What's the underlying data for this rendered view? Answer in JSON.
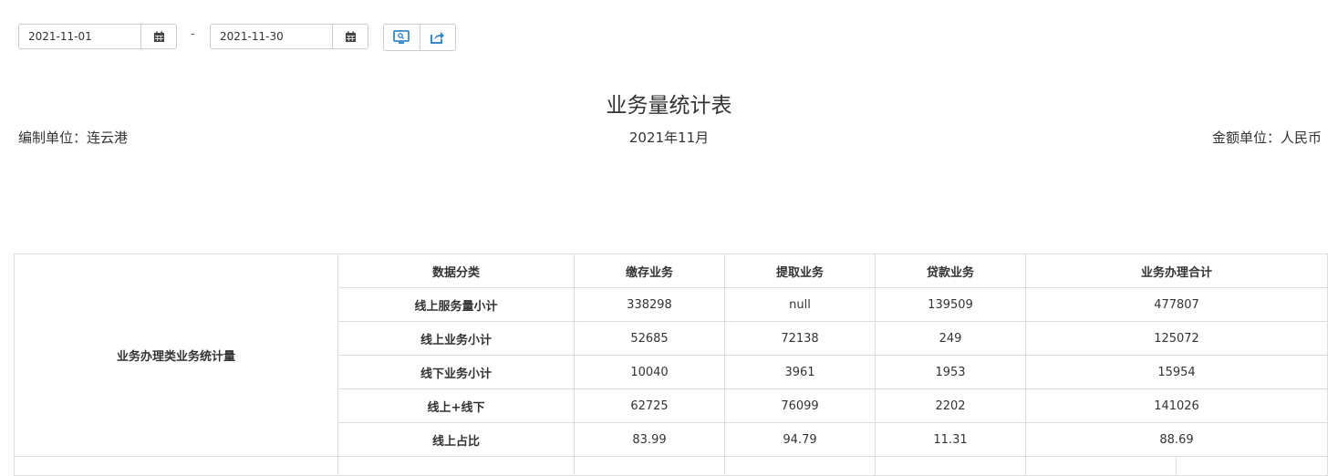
{
  "filters": {
    "start_date": "2021-11-01",
    "end_date": "2021-11-30",
    "separator": "-",
    "calendar_icon": "calendar-icon",
    "buttons": [
      "monitor-icon",
      "share-icon"
    ]
  },
  "report": {
    "title": "业务量统计表",
    "compiler": "编制单位：连云港",
    "period": "2021年11月",
    "currency_unit": "金额单位：人民币"
  },
  "table": {
    "group_label": "业务办理类业务统计量",
    "headers": [
      "数据分类",
      "缴存业务",
      "提取业务",
      "贷款业务",
      "业务办理合计"
    ],
    "rows": [
      {
        "label": "线上服务量小计",
        "values": [
          "338298",
          "null",
          "139509",
          "477807"
        ]
      },
      {
        "label": "线上业务小计",
        "values": [
          "52685",
          "72138",
          "249",
          "125072"
        ]
      },
      {
        "label": "线下业务小计",
        "values": [
          "10040",
          "3961",
          "1953",
          "15954"
        ]
      },
      {
        "label": "线上+线下",
        "values": [
          "62725",
          "76099",
          "2202",
          "141026"
        ]
      },
      {
        "label": "线上占比",
        "values": [
          "83.99",
          "94.79",
          "11.31",
          "88.69"
        ]
      }
    ]
  },
  "colors": {
    "icon_blue": "#3a87c8",
    "border": "#dddddd"
  }
}
